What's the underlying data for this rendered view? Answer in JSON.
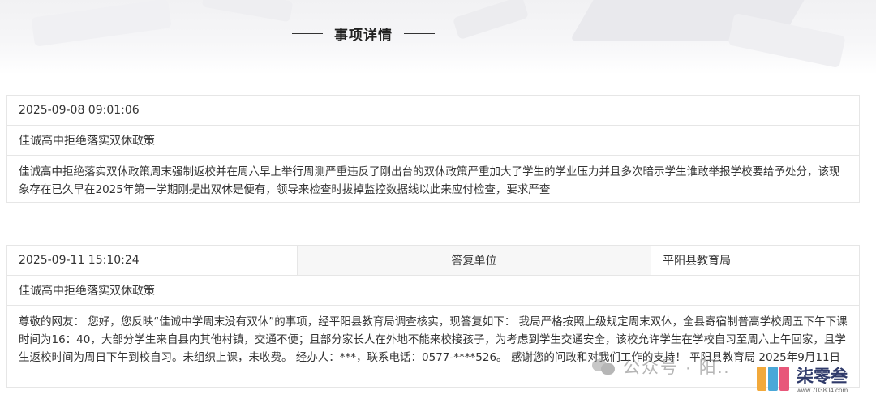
{
  "header": {
    "section_title": "事项详情"
  },
  "inquiry": {
    "timestamp": "2025-09-08 09:01:06",
    "subject": "佳诚高中拒绝落实双休政策",
    "content": "佳诚高中拒绝落实双休政策周末强制返校并在周六早上举行周测严重违反了刚出台的双休政策严重加大了学生的学业压力并且多次暗示学生谁敢举报学校要给予处分，该现象存在已久早在2025年第一学期刚提出双休是便有，领导来检查时拔掉监控数据线以此来应付检查，要求严查"
  },
  "reply": {
    "timestamp": "2025-09-11 15:10:24",
    "unit_label": "答复单位",
    "unit_value": "平阳县教育局",
    "subject": "佳诚高中拒绝落实双休政策",
    "content": "尊敬的网友：  您好，您反映“佳诚中学周末没有双休”的事项，经平阳县教育局调查核实，现答复如下：  我局严格按照上级规定周末双休，全县寄宿制普高学校周五下午下课时间为16：40，大部分学生来自县内其他村镇，交通不便；且部分家长人在外地不能来校接孩子，为考虑到学生交通安全，该校允许学生在学校自习至周六上午回家，且学生返校时间为周日下午到校自习。未组织上课，未收费。 经办人：***，联系电话：0577-****526。 感谢您的问政和对我们工作的支持！  平阳县教育局 2025年9月11日"
  },
  "watermark": {
    "text": "公众号 · 阳..",
    "logo_text": "柒零叁",
    "logo_url": "www.703804.com"
  }
}
